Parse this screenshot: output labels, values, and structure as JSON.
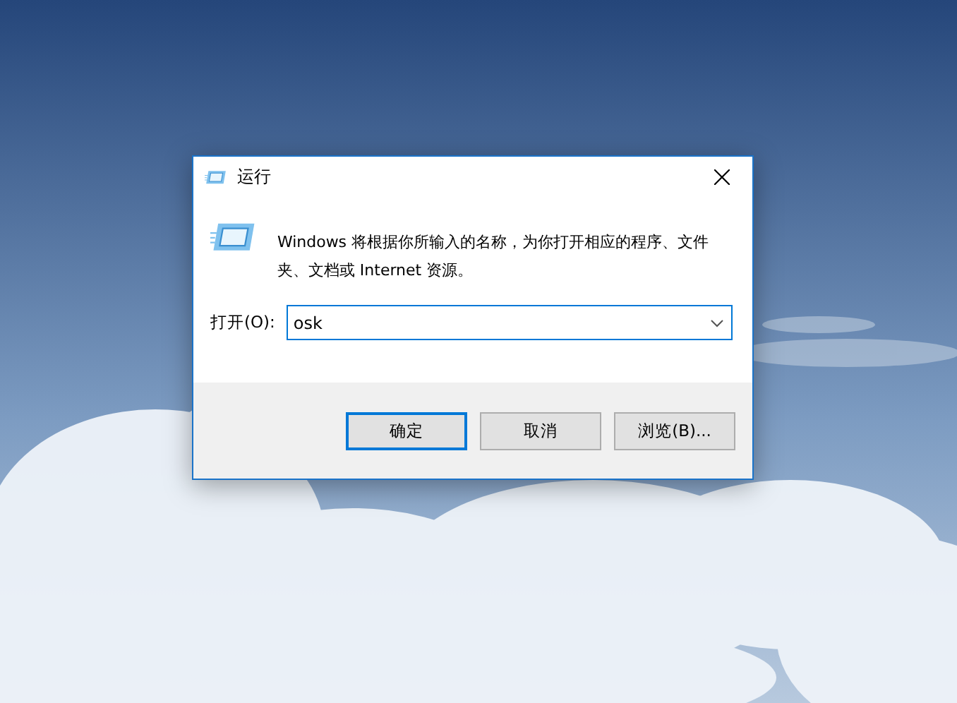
{
  "window": {
    "title": "运行"
  },
  "description": "Windows 将根据你所输入的名称，为你打开相应的程序、文件夹、文档或 Internet 资源。",
  "open_field": {
    "label": "打开(O):",
    "value": "osk"
  },
  "buttons": [
    {
      "label": "确定",
      "default": true
    },
    {
      "label": "取消",
      "default": false
    },
    {
      "label": "浏览(B)...",
      "default": false
    }
  ]
}
